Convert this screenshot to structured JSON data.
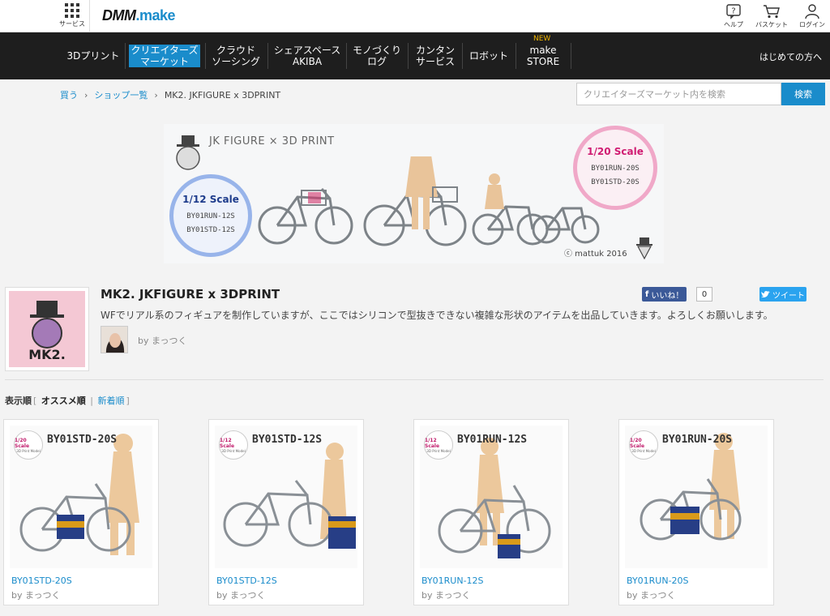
{
  "topbar": {
    "service_label": "サービス",
    "logo_dmm": "DMM",
    "logo_make": ".make",
    "help_label": "ヘルプ",
    "basket_label": "バスケット",
    "login_label": "ログイン"
  },
  "nav": {
    "items": [
      {
        "label": "3Dプリント"
      },
      {
        "label": "クリエイターズ\nマーケット"
      },
      {
        "label": "クラウド\nソーシング"
      },
      {
        "label": "シェアスペース\nAKIBA"
      },
      {
        "label": "モノづくり\nログ"
      },
      {
        "label": "カンタン\nサービス"
      },
      {
        "label": "ロボット"
      },
      {
        "label": "make\nSTORE"
      }
    ],
    "new_badge": "NEW",
    "first_time": "はじめての方へ"
  },
  "breadcrumb": {
    "buy": "買う",
    "shops": "ショップ一覧",
    "current": "MK2. JKFIGURE x 3DPRINT"
  },
  "search": {
    "placeholder": "クリエイターズマーケット内を検索",
    "button": "検索"
  },
  "banner": {
    "title": "JK FIGURE × 3D PRINT",
    "scale_12": "1/12 Scale",
    "scale_12_codes": [
      "BY01RUN-12S",
      "BY01STD-12S"
    ],
    "scale_20": "1/20 Scale",
    "scale_20_codes": [
      "BY01RUN-20S",
      "BY01STD-20S"
    ],
    "copyright": "ⓒ mattuk 2016",
    "logo_text": "MK2."
  },
  "shop": {
    "title": "MK2. JKFIGURE x 3DPRINT",
    "like_label": "いいね！",
    "like_count": "0",
    "tweet_label": "ツイート",
    "description": "WFでリアル系のフィギュアを制作していますが、ここではシリコンで型抜きできない複雑な形状のアイテムを出品していきます。よろしくお願いします。",
    "owner": "by まっつく",
    "thumb_text": "MK2."
  },
  "sort": {
    "label": "表示順",
    "recommended": "オススメ順",
    "newest": "新着順"
  },
  "products": [
    {
      "code": "BY01STD-20S",
      "scale": "1/20 Scale",
      "sub": "3D Print Model",
      "title": "BY01STD-20S",
      "by": "by まっつく"
    },
    {
      "code": "BY01STD-12S",
      "scale": "1/12 Scale",
      "sub": "3D Print Model",
      "title": "BY01STD-12S",
      "by": "by まっつく"
    },
    {
      "code": "BY01RUN-12S",
      "scale": "1/12 Scale",
      "sub": "3D Print Model",
      "title": "BY01RUN-12S",
      "by": "by まっつく"
    },
    {
      "code": "BY01RUN-20S",
      "scale": "1/20 Scale",
      "sub": "3D Print Model",
      "title": "BY01RUN-20S",
      "by": "by まっつく"
    }
  ],
  "colors": {
    "accent": "#1a8ccb",
    "nav_bg": "#1e1e1e",
    "facebook": "#3b5998",
    "twitter": "#2aa3ef"
  }
}
